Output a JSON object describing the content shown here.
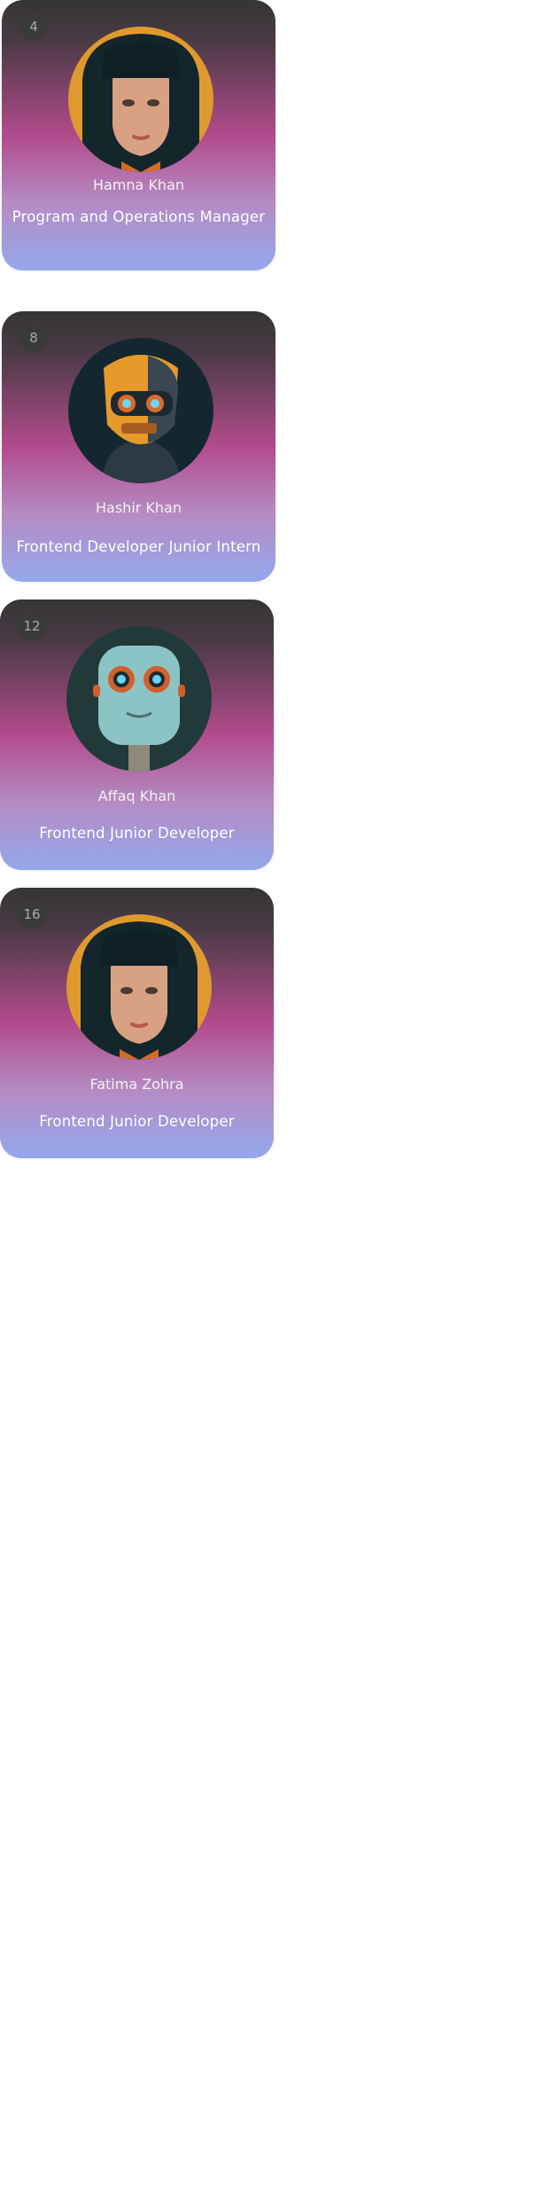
{
  "members": [
    {
      "index": "4",
      "name": "Hamna Khan",
      "role": "Program and Operations Manager",
      "avatar": "girl-avatar-icon"
    },
    {
      "index": "8",
      "name": "Hashir Khan",
      "role": "Frontend Developer Junior Intern",
      "avatar": "orange-robot-avatar-icon"
    },
    {
      "index": "12",
      "name": "Affaq Khan",
      "role": "Frontend Junior Developer",
      "avatar": "cute-robot-avatar-icon"
    },
    {
      "index": "16",
      "name": "Fatima Zohra",
      "role": "Frontend Junior Developer",
      "avatar": "girl-avatar-icon"
    }
  ],
  "colors": {
    "card_top": "#353535",
    "card_mid": "#b24b8c",
    "card_bottom": "#94a8ec",
    "badge_bg": "#3a3a3a"
  }
}
